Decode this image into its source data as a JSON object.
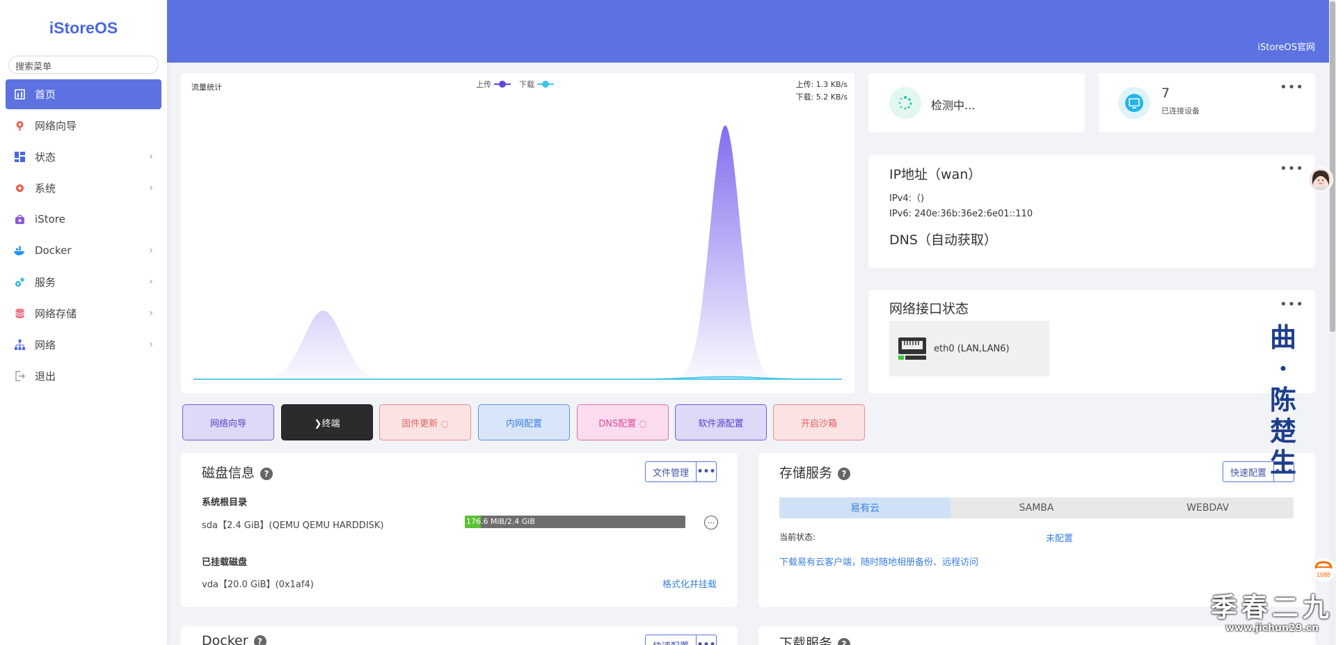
{
  "app": {
    "logo": "iStoreOS",
    "official_link": "iStoreOS官网"
  },
  "search": {
    "placeholder": "搜索菜单"
  },
  "sidebar": {
    "items": [
      {
        "label": "首页",
        "icon": "home-icon",
        "active": true,
        "expandable": false
      },
      {
        "label": "网络向导",
        "icon": "wizard-icon",
        "active": false,
        "expandable": false
      },
      {
        "label": "状态",
        "icon": "dashboard-icon",
        "active": false,
        "expandable": true
      },
      {
        "label": "系统",
        "icon": "gear-icon",
        "active": false,
        "expandable": true
      },
      {
        "label": "iStore",
        "icon": "store-icon",
        "active": false,
        "expandable": false
      },
      {
        "label": "Docker",
        "icon": "docker-icon",
        "active": false,
        "expandable": true
      },
      {
        "label": "服务",
        "icon": "services-icon",
        "active": false,
        "expandable": true
      },
      {
        "label": "网络存储",
        "icon": "storage-icon",
        "active": false,
        "expandable": true
      },
      {
        "label": "网络",
        "icon": "network-icon",
        "active": false,
        "expandable": true
      },
      {
        "label": "退出",
        "icon": "logout-icon",
        "active": false,
        "expandable": false
      }
    ]
  },
  "traffic": {
    "title": "流量统计",
    "legend_upload": "上传",
    "legend_download": "下载",
    "upload_rate": "上传: 1.3 KB/s",
    "download_rate": "下载: 5.2 KB/s"
  },
  "chart_data": {
    "type": "area",
    "title": "流量统计",
    "series": [
      {
        "name": "上传",
        "color": "#7b66ee",
        "peaks": [
          {
            "center": 0.2,
            "height": 0.27,
            "width": 0.03
          },
          {
            "center": 0.82,
            "height": 1.0,
            "width": 0.023
          }
        ]
      },
      {
        "name": "下载",
        "color": "#3fc3ea",
        "peaks": [
          {
            "center": 0.82,
            "height": 0.01,
            "width": 0.05
          }
        ]
      }
    ]
  },
  "quick_buttons": [
    {
      "label": "网络向导",
      "bg": "#dcdaf7",
      "border": "#6b5ce0",
      "color": "#5544cc"
    },
    {
      "label": "❯终端",
      "bg": "#2b2b2b",
      "border": "#1a1a1a",
      "color": "#ffffff"
    },
    {
      "label": "固件更新 ◌",
      "bg": "#fbe3e3",
      "border": "#e88a8a",
      "color": "#e06060"
    },
    {
      "label": "内网配置",
      "bg": "#d9e6fa",
      "border": "#5b8ee0",
      "color": "#3a7fe0"
    },
    {
      "label": "DNS配置 ◌",
      "bg": "#fbdcee",
      "border": "#e070b0",
      "color": "#d64ea0"
    },
    {
      "label": "软件源配置",
      "bg": "#dcdaf7",
      "border": "#6b5ce0",
      "color": "#5544cc"
    },
    {
      "label": "开启沙箱",
      "bg": "#fbe3e3",
      "border": "#e88a8a",
      "color": "#e06060"
    }
  ],
  "status": {
    "checking": "检测中...",
    "devices_count": "7",
    "devices_label": "已连接设备"
  },
  "ip": {
    "title": "IP地址（wan）",
    "ipv4": "IPv4:（)",
    "ipv6": "IPv6: 240e:36b:36e2:6e01::110",
    "dns": "DNS（自动获取）"
  },
  "net_interface": {
    "title": "网络接口状态",
    "iface": "eth0 (LAN,LAN6)"
  },
  "disk": {
    "title": "磁盘信息",
    "file_manager": "文件管理",
    "root_label": "系统根目录",
    "root_disk": "sda【2.4 GiB】(QEMU QEMU HARDDISK)",
    "usage_text": "176.6 MiB/2.4 GiB",
    "usage_fraction": 0.072,
    "mounted_label": "已挂载磁盘",
    "mounted_disk": "vda【20.0 GiB】(0x1af4)",
    "format_action": "格式化并挂载"
  },
  "storage": {
    "title": "存储服务",
    "quick_config": "快速配置",
    "tabs": [
      "易有云",
      "SAMBA",
      "WEBDAV"
    ],
    "status_label": "当前状态:",
    "status_value": "未配置",
    "link": "下载易有云客户端，随时随地相册备份、远程访问"
  },
  "docker_card": {
    "title": "Docker",
    "quick_config": "快速配置"
  },
  "download_card": {
    "title": "下载服务"
  },
  "overlay": {
    "vertical_text": "曲·陈楚生",
    "watermark": "季春二九",
    "watermark_url": "www.jichun29.cn",
    "badge": "1688"
  }
}
